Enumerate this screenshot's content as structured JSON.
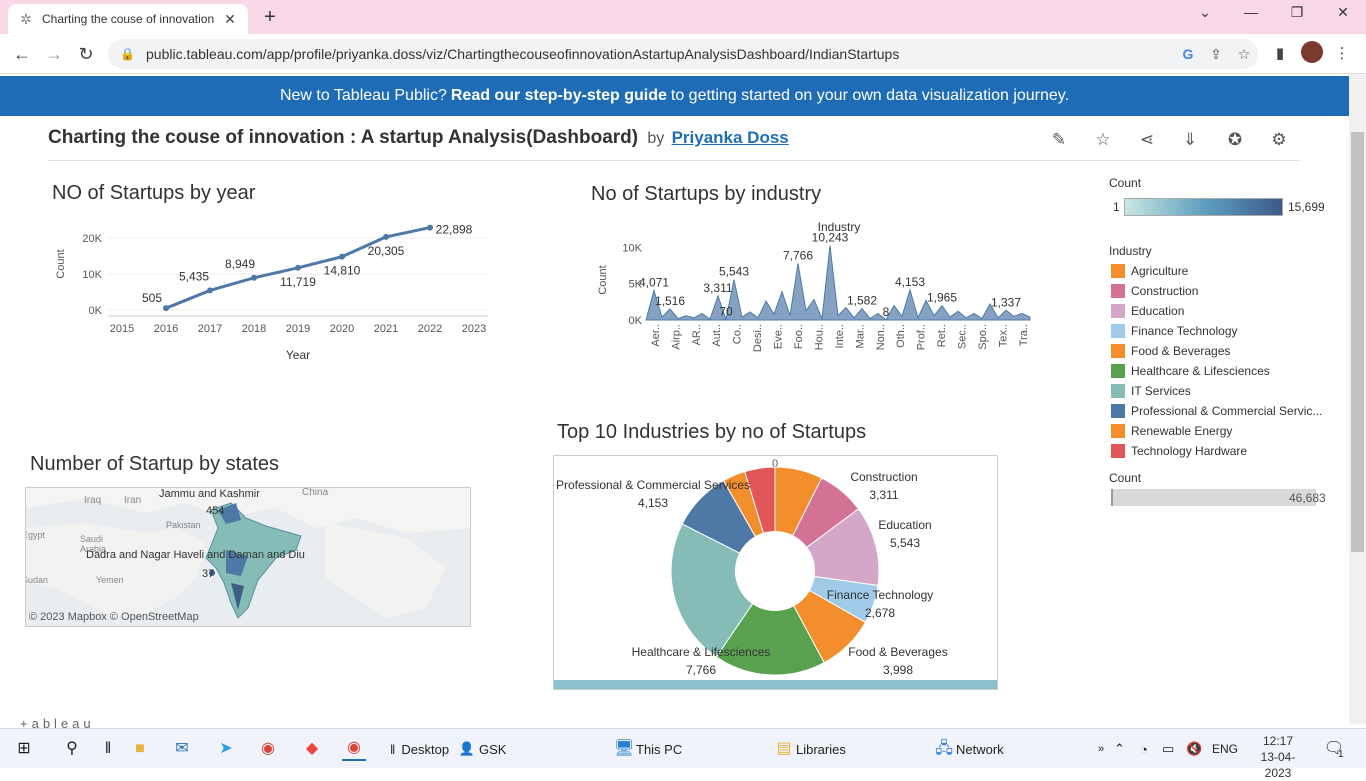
{
  "browser": {
    "tab_title": "Charting the couse of innovation",
    "new_tab": "+",
    "url": "public.tableau.com/app/profile/priyanka.doss/viz/ChartingthecouseofinnovationAstartupAnalysisDashboard/IndianStartups"
  },
  "banner": {
    "prefix": "New to Tableau Public?",
    "link": "Read our step-by-step guide",
    "suffix": "to getting started on your own data visualization journey."
  },
  "viz": {
    "title": "Charting the couse of innovation : A startup Analysis(Dashboard)",
    "by": "by",
    "author": "Priyanka Doss"
  },
  "sections": {
    "year": "NO of Startups by year",
    "industry": "No of Startups by industry",
    "states": "Number of Startup by states",
    "top10": "Top 10 Industries by no of Startups"
  },
  "chart_data": [
    {
      "type": "line",
      "xlabel": "Year",
      "ylabel": "Count",
      "x_ticks": [
        "2015",
        "2016",
        "2017",
        "2018",
        "2019",
        "2020",
        "2021",
        "2022",
        "2023"
      ],
      "y_ticks": [
        "0K",
        "10K",
        "20K"
      ],
      "xlim": [
        2015,
        2023
      ],
      "ylim": [
        0,
        25000
      ],
      "x": [
        2016,
        2017,
        2018,
        2019,
        2020,
        2021,
        2022
      ],
      "values": [
        505,
        5435,
        8949,
        11719,
        14810,
        20305,
        22898
      ],
      "labels": [
        "505",
        "5,435",
        "8,949",
        "11,719",
        "14,810",
        "20,305",
        "22,898"
      ]
    },
    {
      "type": "area",
      "title": "Industry",
      "ylabel": "Count",
      "y_ticks": [
        "0K",
        "5K",
        "10K"
      ],
      "ylim": [
        0,
        11000
      ],
      "categories": [
        "Aer..",
        "Airp..",
        "AR..",
        "Aut..",
        "Co..",
        "Desi..",
        "Eve..",
        "Foo..",
        "Hou..",
        "Inte..",
        "Mar..",
        "Non..",
        "Oth..",
        "Prof..",
        "Ret..",
        "Sec..",
        "Spo..",
        "Tex..",
        "Tra.."
      ],
      "profile": [
        0,
        4071,
        400,
        1516,
        200,
        600,
        300,
        900,
        100,
        3311,
        70,
        5543,
        400,
        1100,
        300,
        2600,
        800,
        3900,
        600,
        7766,
        1300,
        2800,
        200,
        10243,
        600,
        1700,
        300,
        1582,
        200,
        900,
        8,
        2000,
        500,
        4153,
        300,
        2700,
        600,
        1965,
        400,
        1200,
        300,
        900,
        200,
        2200,
        300,
        1337,
        500,
        900,
        400
      ],
      "labels": [
        {
          "text": "4,071",
          "idx": 1
        },
        {
          "text": "1,516",
          "idx": 3
        },
        {
          "text": "3,311",
          "idx": 9
        },
        {
          "text": "70",
          "idx": 10
        },
        {
          "text": "5,543",
          "idx": 11
        },
        {
          "text": "7,766",
          "idx": 19
        },
        {
          "text": "10,243",
          "idx": 23
        },
        {
          "text": "1,582",
          "idx": 27
        },
        {
          "text": "8",
          "idx": 30
        },
        {
          "text": "4,153",
          "idx": 33
        },
        {
          "text": "1,965",
          "idx": 37
        },
        {
          "text": "1,337",
          "idx": 45
        }
      ]
    },
    {
      "type": "pie",
      "title": "Top 10 Industries by no of Startups",
      "top_label": "0",
      "slices": [
        {
          "name": "Construction",
          "value": 3311,
          "label": "3,311",
          "color": "#f28e2b"
        },
        {
          "name": "Construction",
          "value": 3311,
          "label": "",
          "color": "#d37295"
        },
        {
          "name": "Education",
          "value": 5543,
          "label": "5,543",
          "color": "#d4a6c8"
        },
        {
          "name": "Finance Technology",
          "value": 2678,
          "label": "2,678",
          "color": "#a0cbe8"
        },
        {
          "name": "Food & Beverages",
          "value": 3998,
          "label": "3,998",
          "color": "#f28e2b"
        },
        {
          "name": "Healthcare & Lifesciences",
          "value": 7766,
          "label": "7,766",
          "color": "#59a14f"
        },
        {
          "name": "IT Services",
          "value": 10243,
          "label": "",
          "color": "#86bcb6"
        },
        {
          "name": "Professional & Commercial Services",
          "value": 4153,
          "label": "4,153",
          "color": "#4e79a7"
        },
        {
          "name": "Renewable Energy",
          "value": 1582,
          "label": "",
          "color": "#f28e2b"
        },
        {
          "name": "Technology Hardware",
          "value": 2100,
          "label": "",
          "color": "#e15759"
        }
      ]
    }
  ],
  "legends": {
    "count_title": "Count",
    "count_min": "1",
    "count_max": "15,699",
    "industry_title": "Industry",
    "industries": [
      {
        "name": "Agriculture",
        "color": "#f28e2b"
      },
      {
        "name": "Construction",
        "color": "#d37295"
      },
      {
        "name": "Education",
        "color": "#d4a6c8"
      },
      {
        "name": "Finance Technology",
        "color": "#a0cbe8"
      },
      {
        "name": "Food & Beverages",
        "color": "#f28e2b"
      },
      {
        "name": "Healthcare & Lifesciences",
        "color": "#59a14f"
      },
      {
        "name": "IT Services",
        "color": "#86bcb6"
      },
      {
        "name": "Professional & Commercial Servic...",
        "color": "#4e79a7"
      },
      {
        "name": "Renewable Energy",
        "color": "#f28e2b"
      },
      {
        "name": "Technology Hardware",
        "color": "#e15759"
      }
    ],
    "count2_title": "Count",
    "count2_value": "46,683"
  },
  "map": {
    "labels": [
      "Iraq",
      "Iran",
      "China",
      "Pakistan",
      "Saudi Arabia",
      "Yemen",
      "Egypt",
      "Sudan"
    ],
    "state1": "Jammu and Kashmir",
    "state1_value": "454",
    "state2": "Dadra and Nagar Haveli and Daman and Diu",
    "state2_value": "37",
    "attribution": "© 2023 Mapbox  © OpenStreetMap"
  },
  "footer": {
    "brand": "+ableau"
  },
  "taskbar": {
    "desktop": "Desktop",
    "user": "GSK",
    "this_pc": "This PC",
    "libraries": "Libraries",
    "network": "Network",
    "lang": "ENG",
    "time": "12:17",
    "date": "13-04-2023",
    "notif": "1"
  }
}
